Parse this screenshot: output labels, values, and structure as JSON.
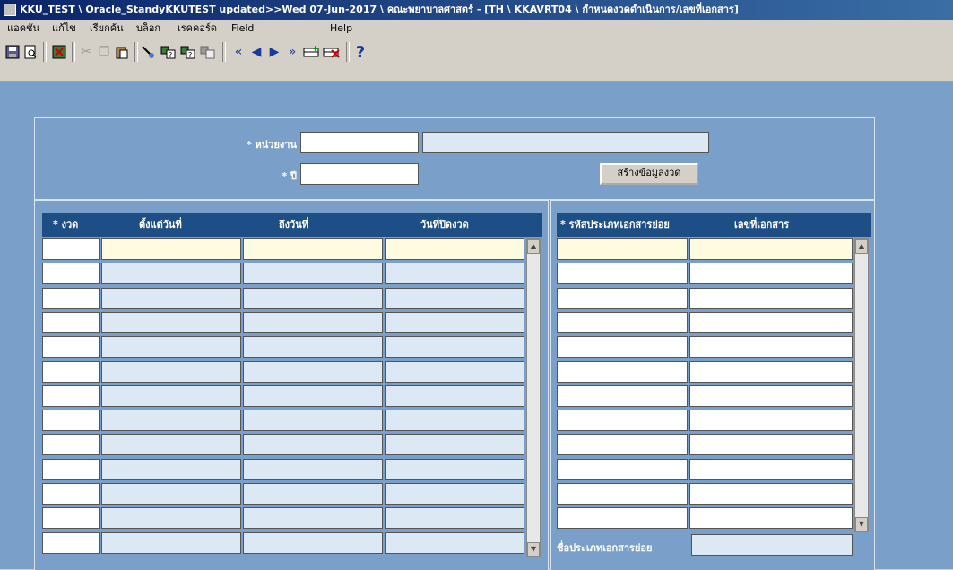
{
  "window": {
    "title": "KKU_TEST \\ Oracle_StandyKKUTEST updated>>Wed 07-Jun-2017 \\ คณะพยาบาลศาสตร์ - [TH \\ KKAVRT04 \\ กำหนดงวดดำเนินการ/เลขที่เอกสาร]"
  },
  "menu": [
    "แอคชัน",
    "แก้ไข",
    "เรียกค้น",
    "บล็อก",
    "เรคคอร์ด",
    "Field",
    "Help"
  ],
  "toolbar": {
    "icons": [
      "save-icon",
      "print-preview-icon",
      "exit-icon",
      "cut-icon",
      "copy-icon",
      "paste-icon",
      "enter-query-icon",
      "execute-query-icon",
      "count-query-icon",
      "cancel-query-icon",
      "first-record-icon",
      "previous-record-icon",
      "next-record-icon",
      "last-record-icon",
      "insert-record-icon",
      "delete-record-icon",
      "help-icon"
    ],
    "help_glyph": "?"
  },
  "header_form": {
    "unit_label": "* หน่วยงาน",
    "unit_code": "",
    "unit_name": "",
    "year_label": "* ปี",
    "year_value": "",
    "create_button": "สร้างข้อมูลงวด"
  },
  "period_grid": {
    "columns": [
      "* งวด",
      "ตั้งแต่วันที่",
      "ถึงวันที่",
      "วันที่ปิดงวด"
    ],
    "row_count": 13
  },
  "doc_grid": {
    "columns": [
      "* รหัสประเภทเอกสารย่อย",
      "เลขที่เอกสาร"
    ],
    "row_count": 12,
    "footer_label": "ชื่อประเภทเอกสารย่อย",
    "footer_value": ""
  },
  "colors": {
    "canvas": "#7a9fc8",
    "grid_header": "#1e4e86",
    "readonly_cell": "#dce8f4",
    "current_row": "#fffbe0"
  }
}
